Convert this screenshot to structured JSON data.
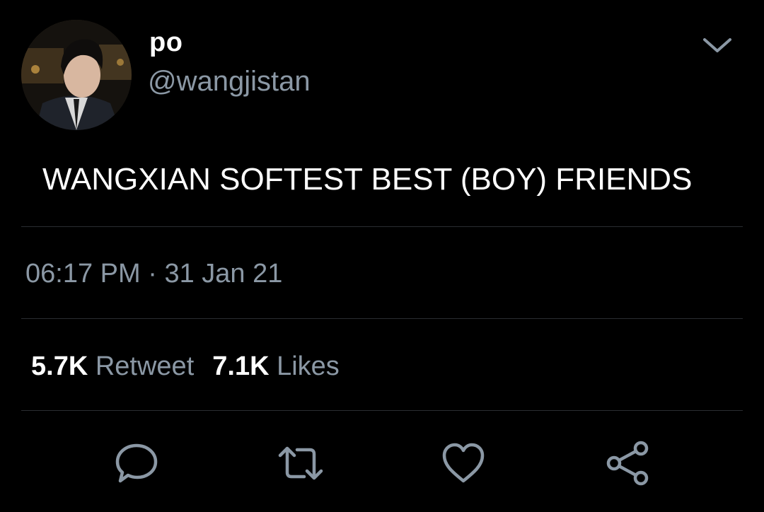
{
  "tweet": {
    "display_name": "po",
    "handle": "@wangjistan",
    "text": "WANGXIAN SOFTEST BEST (BOY) FRIENDS",
    "time": "06:17 PM",
    "separator": "·",
    "date": "31 Jan 21",
    "retweet_count": "5.7K",
    "retweet_label": "Retweet",
    "like_count": "7.1K",
    "like_label": "Likes"
  },
  "icons": {
    "menu": "chevron-down-icon",
    "reply": "comment-icon",
    "retweet": "retweet-icon",
    "like": "heart-icon",
    "share": "share-icon"
  },
  "colors": {
    "background": "#000000",
    "primary_text": "#ffffff",
    "secondary_text": "#8b98a5",
    "divider": "#2a2d31"
  }
}
